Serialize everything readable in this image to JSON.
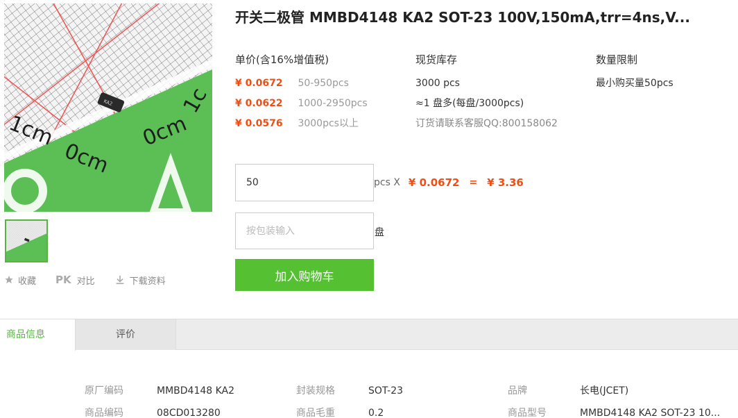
{
  "product": {
    "title": "开关二极管 MMBD4148 KA2 SOT-23 100V,150mA,trr=4ns,V..."
  },
  "gallery": {
    "image_labels": [
      "1cm",
      "0cm",
      "0cm",
      "1c"
    ],
    "part_marking": "KA2"
  },
  "actions": {
    "favorite": "收藏",
    "pk_badge": "PK",
    "compare": "对比",
    "download": "下载资料"
  },
  "pricing": {
    "header": "单价(含16%增值税)",
    "tiers": [
      {
        "price": "¥ 0.0672",
        "range": "50-950pcs"
      },
      {
        "price": "¥ 0.0622",
        "range": "1000-2950pcs"
      },
      {
        "price": "¥ 0.0576",
        "range": "3000pcs以上"
      }
    ]
  },
  "stock": {
    "header": "现货库存",
    "qty": "3000 pcs",
    "reels": "≈1 盘多(每盘/3000pcs)",
    "order_note": "订货请联系客服QQ:800158062"
  },
  "limit": {
    "header": "数量限制",
    "min": "最小购买量50pcs"
  },
  "order": {
    "quantity": "50",
    "unit": "pcs X",
    "unit_price": "¥ 0.0672",
    "equals": "=",
    "total": "¥ 3.36",
    "reel_placeholder": "按包装输入",
    "reel_unit": "盘",
    "add_to_cart": "加入购物车"
  },
  "tabs": [
    {
      "label": "商品信息"
    },
    {
      "label": "评价"
    }
  ],
  "specs": [
    {
      "key": "原厂编码",
      "value": "MMBD4148 KA2"
    },
    {
      "key": "封装规格",
      "value": "SOT-23"
    },
    {
      "key": "品牌",
      "value": "长电(JCET)"
    },
    {
      "key": "商品编码",
      "value": "08CD013280"
    },
    {
      "key": "商品毛重",
      "value": "0.2"
    },
    {
      "key": "商品型号",
      "value": "MMBD4148 KA2 SOT-23 10..."
    }
  ],
  "colors": {
    "accent_green": "#55c132",
    "price_orange": "#f04e12"
  }
}
